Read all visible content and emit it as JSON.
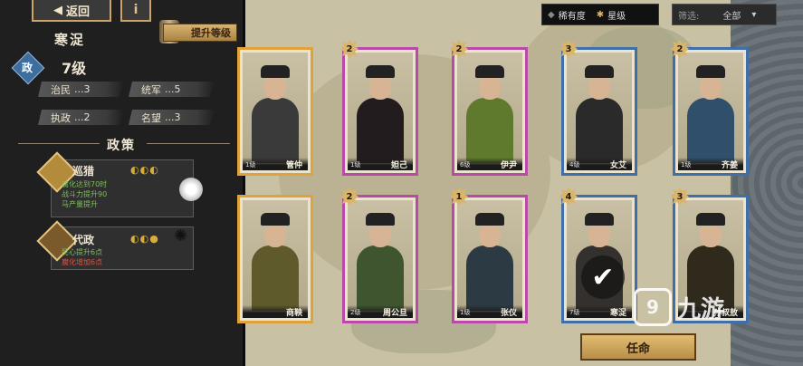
{
  "header": {
    "back_label": "返回",
    "info_label": "i",
    "upgrade_label": "提升等级"
  },
  "city": {
    "name": "寒浞",
    "level_badge": "政",
    "level": "7级",
    "stats": [
      {
        "label": "治民",
        "value": "...3"
      },
      {
        "label": "统军",
        "value": "...5"
      },
      {
        "label": "执政",
        "value": "...2"
      },
      {
        "label": "名望",
        "value": "...3"
      }
    ]
  },
  "policy": {
    "title": "政策",
    "items": [
      {
        "name": "巡猎",
        "icon": "hunting-icon",
        "rating": "◐◐◐",
        "lines": [
          {
            "text": "腐化达到70时",
            "color": "#7fbf5a"
          },
          {
            "text": "战斗力提升90",
            "color": "#7fbf5a"
          },
          {
            "text": "马产量提升",
            "color": "#7fbf5a"
          }
        ]
      },
      {
        "name": "代政",
        "icon": "regency-icon",
        "rating": "◐◐●",
        "lines": [
          {
            "text": "民心提升6点",
            "color": "#7fbf5a"
          },
          {
            "text": "腐化增加6点",
            "color": "#e0503c"
          }
        ]
      }
    ]
  },
  "filters": {
    "rarity_label": "稀有度",
    "star_label": "星级",
    "filter_label": "筛选:",
    "filter_value": "全部"
  },
  "cards": [
    {
      "name": "管仲",
      "level": "1级",
      "stars": null,
      "frame": "#e0a23a",
      "robe": "#3a3a3a"
    },
    {
      "name": "妲己",
      "level": "1级",
      "stars": "2",
      "frame": "#b94aa8",
      "robe": "#231c1f"
    },
    {
      "name": "伊尹",
      "level": "6级",
      "stars": "2",
      "frame": "#b94aa8",
      "robe": "#5f7a2c"
    },
    {
      "name": "女艾",
      "level": "4级",
      "stars": "3",
      "frame": "#3f6ea8",
      "robe": "#2a2a2a"
    },
    {
      "name": "齐姜",
      "level": "1级",
      "stars": "2",
      "frame": "#3f6ea8",
      "robe": "#2f4f6a"
    },
    {
      "name": "商鞅",
      "level": "",
      "stars": null,
      "frame": "#e0a23a",
      "robe": "#5e5a2c"
    },
    {
      "name": "周公旦",
      "level": "2级",
      "stars": "2",
      "frame": "#b94aa8",
      "robe": "#3f5530"
    },
    {
      "name": "张仪",
      "level": "1级",
      "stars": "1",
      "frame": "#b94aa8",
      "robe": "#2c3a44"
    },
    {
      "name": "寒浞",
      "level": "7级",
      "stars": "4",
      "frame": "#3f6ea8",
      "robe": "#34302e"
    },
    {
      "name": "孙叔敖",
      "level": "",
      "stars": "3",
      "frame": "#3f6ea8",
      "robe": "#2f2a1c"
    }
  ],
  "appoint_label": "任命",
  "watermark": "九游",
  "colors": {
    "gold": "#c9a56a",
    "panel": "#1f1f1f"
  }
}
